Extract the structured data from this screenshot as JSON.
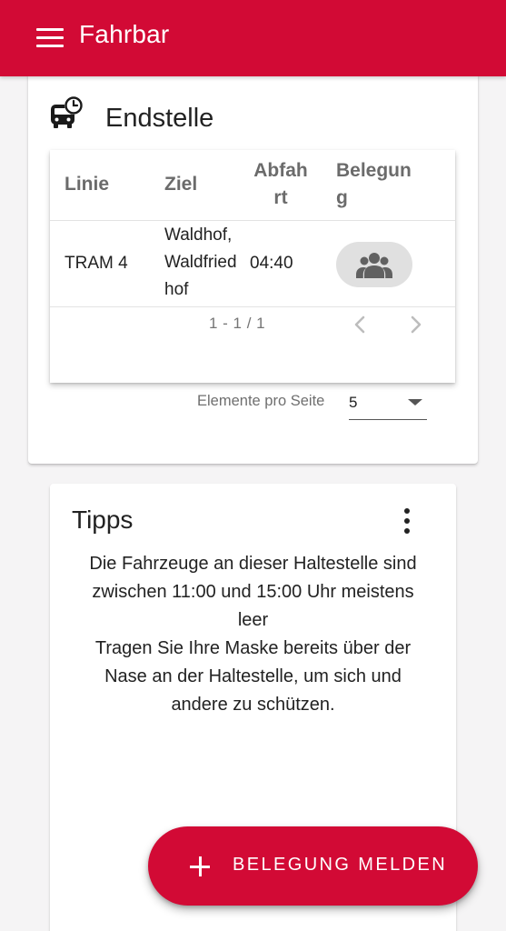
{
  "app": {
    "title": "Fahrbar",
    "brand_color": "#d20a35",
    "menu_icon": "menu-icon"
  },
  "endstelle": {
    "title": "Endstelle",
    "icon": "bus-clock-icon",
    "table": {
      "headers": {
        "linie": "Linie",
        "ziel": "Ziel",
        "abfahrt_line1": "Abfah",
        "abfahrt_line2": "rt",
        "belegung_line1": "Belegun",
        "belegung_line2": "g"
      },
      "rows": [
        {
          "linie": "TRAM 4",
          "ziel_line1": "Waldhof,",
          "ziel_line2": "Waldfried",
          "ziel_line3": "hof",
          "abfahrt": "04:40",
          "belegung_icon": "group-icon"
        }
      ]
    },
    "pagination": {
      "range": "1 - 1 / 1",
      "per_page_label": "Elemente pro Seite",
      "per_page_value": "5"
    }
  },
  "tipps": {
    "title": "Tipps",
    "text_line1": "Die Fahrzeuge an dieser Haltestelle sind",
    "text_line2": "zwischen 11:00 und 15:00 Uhr meistens",
    "text_line3": "leer",
    "text_line4": "Tragen Sie Ihre Maske bereits über der",
    "text_line5": "Nase an der Haltestelle, um sich und",
    "text_line6": "andere zu schützen."
  },
  "fab": {
    "label": "BELEGUNG MELDEN",
    "icon": "plus-icon"
  }
}
